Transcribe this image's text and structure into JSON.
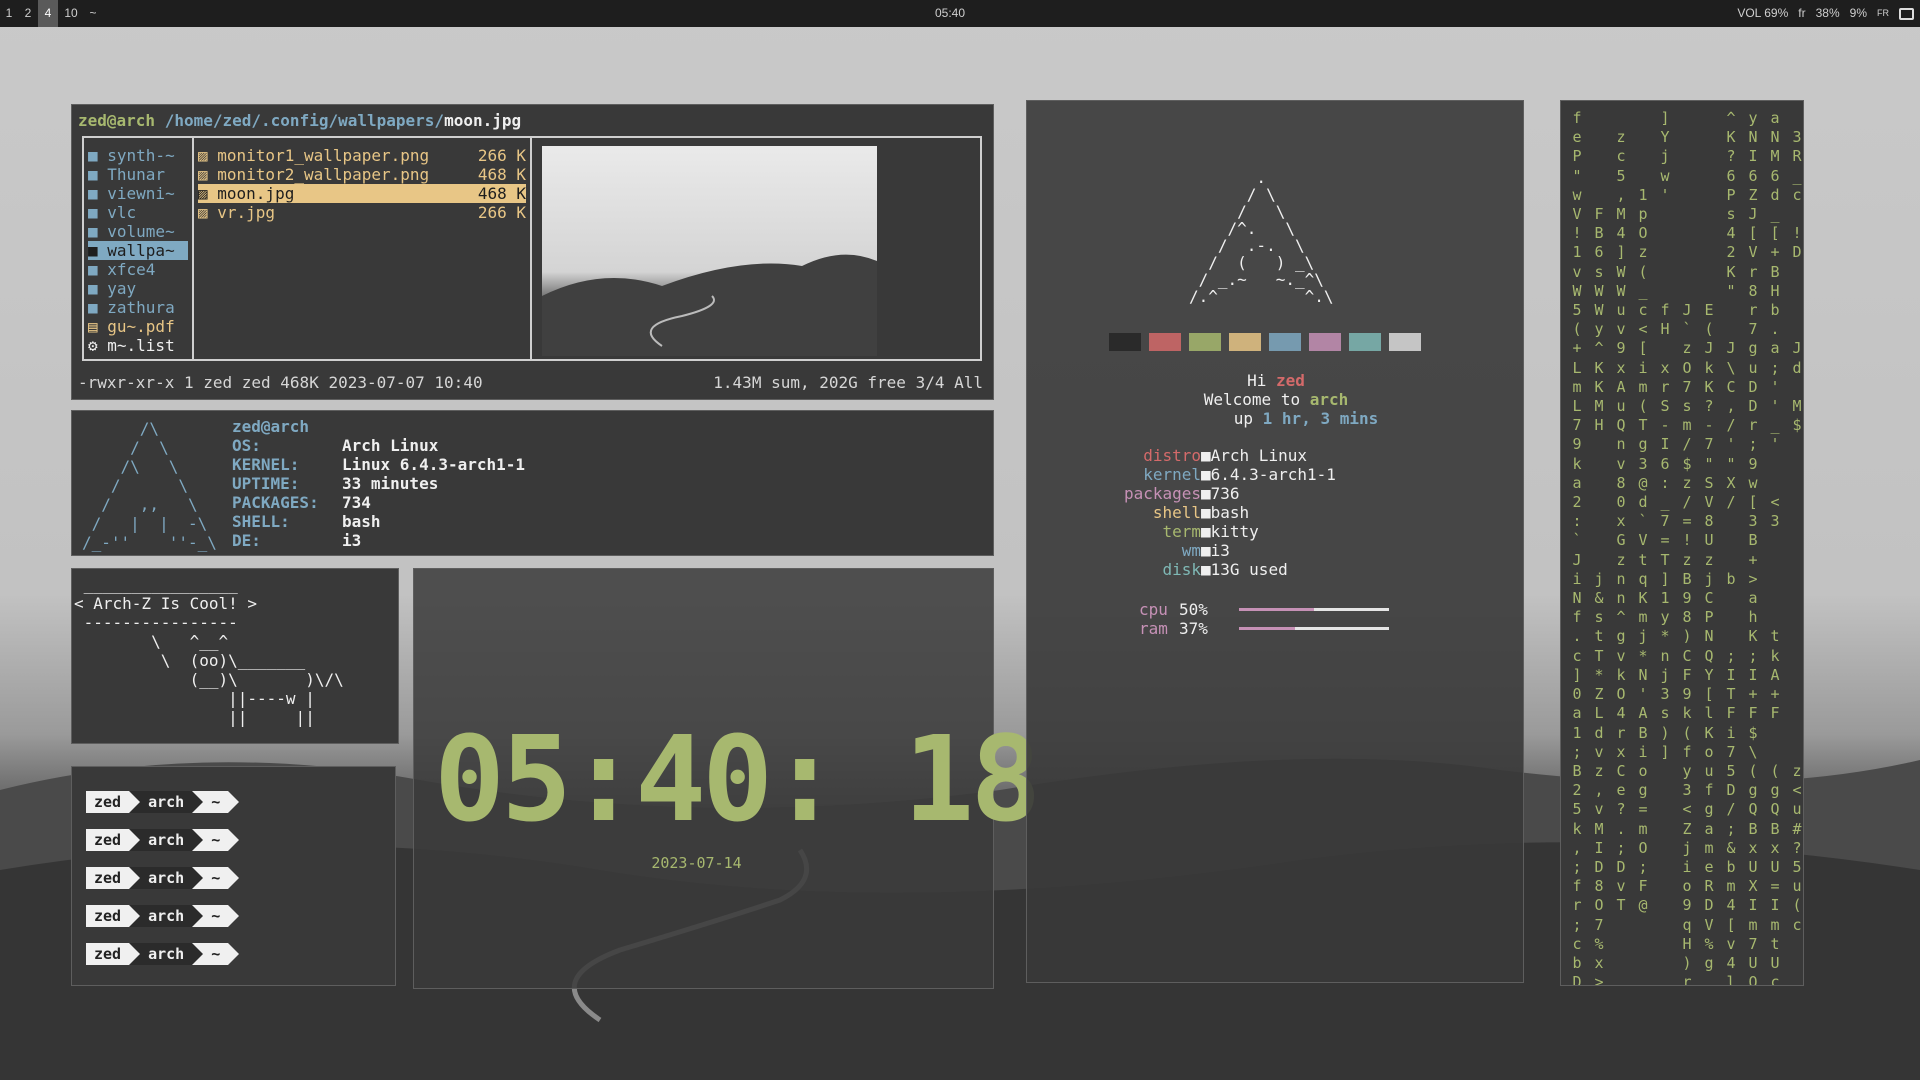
{
  "topbar": {
    "workspaces": [
      "1",
      "2",
      "4",
      "10",
      "~"
    ],
    "active_workspace": "4",
    "clock": "05:40",
    "status": {
      "vol": "VOL",
      "vol_value": "69%",
      "layout": "fr",
      "battery": "38%",
      "cpu": "9%",
      "lang": "FR"
    }
  },
  "file_manager": {
    "path_user": "zed@arch",
    "path_dir": "/home/zed/.config/wallpapers/",
    "path_file": "moon.jpg",
    "dirs": [
      "synth-~",
      "Thunar",
      "viewni~",
      "vlc",
      "volume~",
      "wallpa~",
      "xfce4",
      "yay",
      "zathura",
      "gu~.pdf",
      "m~.list"
    ],
    "selected_dir": "wallpa~",
    "files": [
      {
        "name": "monitor1_wallpaper.png",
        "size": "266 K"
      },
      {
        "name": "monitor2_wallpaper.png",
        "size": "468 K"
      },
      {
        "name": "moon.jpg",
        "size": "468 K"
      },
      {
        "name": "vr.jpg",
        "size": "266 K"
      }
    ],
    "selected_file": "moon.jpg",
    "status_left": "-rwxr-xr-x 1 zed zed 468K 2023-07-07 10:40",
    "status_right": "1.43M sum, 202G free  3/4  All"
  },
  "neofetch": {
    "user": "zed@arch",
    "rows": [
      {
        "key": "OS:",
        "value": "Arch Linux"
      },
      {
        "key": "KERNEL:",
        "value": "Linux 6.4.3-arch1-1"
      },
      {
        "key": "UPTIME:",
        "value": "33 minutes"
      },
      {
        "key": "PACKAGES:",
        "value": "734"
      },
      {
        "key": "SHELL:",
        "value": "bash"
      },
      {
        "key": "DE:",
        "value": "i3"
      }
    ]
  },
  "cowsay": {
    "text": " ________________\n< Arch-Z Is Cool! >\n ----------------\n        \\   ^__^\n         \\  (oo)\\_______\n            (__)\\       )\\/\\\n                ||----w |\n                ||     ||"
  },
  "prompts": {
    "user": "zed",
    "host": "arch",
    "dir": "~",
    "count": 5
  },
  "big_clock": {
    "time": "05:40: 18",
    "date": "2023-07-14"
  },
  "fetch": {
    "greeting_hi": "Hi",
    "greeting_user": "zed",
    "welcome": "Welcome to",
    "welcome_host": "arch",
    "up_label": "up",
    "up_value": "1 hr, 3 mins",
    "info": [
      {
        "key": "distro",
        "value": "Arch Linux",
        "color": "#d46a6a"
      },
      {
        "key": "kernel",
        "value": "6.4.3-arch1-1",
        "color": "#7fa9c2"
      },
      {
        "key": "packages",
        "value": "736",
        "color": "#c691b6"
      },
      {
        "key": "shell",
        "value": "bash",
        "color": "#e8c686"
      },
      {
        "key": "term",
        "value": "kitty",
        "color": "#a7b86f"
      },
      {
        "key": "wm",
        "value": "i3",
        "color": "#7fa9c2"
      },
      {
        "key": "disk",
        "value": "13G used",
        "color": "#7fb8b5"
      }
    ],
    "cpu_label": "cpu",
    "cpu_value": "50%",
    "cpu_fraction": 0.5,
    "ram_label": "ram",
    "ram_value": "37%",
    "ram_fraction": 0.37,
    "palette": [
      "#262626",
      "#d46a6a",
      "#a7b86f",
      "#e8c686",
      "#7fa9c2",
      "#c691b6",
      "#7fb8b5",
      "#dcdcdc"
    ]
  },
  "matrix": {
    "columns": [
      "f\ne\nP\n\"\nw\nV\n!\n1\nv\nW\n5\n(\n+\nL\nm\nL\n7\n9\nk\na\n2\n:\n`\nJ\ni\nN\nf\n.\nc\n]\n0\na\n1\n;\nB\n2\n5\nk\n,\n;\nf\nr\n;\nc\nb\nD",
      "\n\n\n\n\nF\nB\n6\ns\nW\nW\ny\n^\nK\nK\nM\nH\n\n\n\n\n\n\n\nj\n&\ns\nt\nT\n*\nZ\nL\nd\nv\nz\n,\nv\nM\nI\nD\n8\nO\n7\n%\nx\n>",
      "\nz\nc\n5\n,\nM\n4\n]\nW\nW\nu\nv\n9\nx\nA\nu\nQ\nn\nv\n8\n0\nx\nG\nz\nn\nn\n^\ng\nv\nk\nO\n4\nr\nx\nC\ne\n?\n.\n;\nD\nv\nT\n\n\n\n",
      "\n\n\n\n1\np\nO\nz\n(\n_\nc\n<\n[\ni\nm\n(\nT\ng\n3\n@\nd\n`\nV\nt\nq\nK\nm\nj\n*\nN\n'\nA\nB\ni\no\ng\n=\nm\nO\n;\nF\n@\n\n\n\n",
      "]\nY\nj\nw\n'\n\n\n\n\n\nf\nH\n\nx\nr\nS\n-\nI\n6\n:\n_\n7\n=\nT\n]\n1\ny\n*\nn\nj\n3\ns\n)\n]\n\n\n\n\n\n\n\n\n\n\n\n",
      "\n\n\n\n\n\n\n\n\n\nJ\n`\nz\nO\n7\ns\nm\n/\n$\nz\n/\n=\n!\nz\nB\n9\n8\n)\nC\nF\n9\nk\n(\nf\ny\n3\n<\nZ\nj\ni\no\n9\nq\nH\n)\nr",
      "\n\n\n\n\n\n\n\n\n\nE\n(\nJ\nk\nK\n?\n-\n7\n\"\nS\nV\n8\nU\nz\nj\nC\nP\nN\nQ\nY\n[\nl\nK\no\nu\nf\ng\na\nm\ne\nR\nD\nV\n%\ng",
      "^\nK\n?\n6\nP\ns\n4\n2\nK\n\"\n\n\nJ\n\\\nC\n,\n/\n'\n\"\nX\n/\n\n\n\nb\n\n\n\n;\nI\nT\nF\ni\n7\n5\nD\n/\n;\n&\nb\nm\n4\n[\nv\n4\nl",
      "y\nN\nI\n6\nZ\nJ\n[\nV\nr\n8\nr\n7\ng\nu\nD\nD\nr\n;\n9\nw\n[\n3\nB\n+\n>\na\nh\nK\n;\nI\n+\nF\n$\n\\\n(\ng\nQ\nB\nx\nU\nX\nI\nm\n7\nU\nQ",
      "a\nN\nM\n6\nd\n_\n[\n+\nB\nH\nb\n.\na\n;\n'\n'\n_\n'\n\n\n<\n3\n\n\n\n\n\nt\nk\nA\n+\nF\n\n\n(\ng\nQ\nB\nx\nU\n=\nI\nm\nt\nU\nc",
      "\n3\nR\n_\nc\n\n!\nD\n\n\n\n\nJ\nd\n\nM\n$\n\n\n\n\n\n\n\n\n\n\n\n\n\n\n\n\n\nz\n<\nu\n#\n?\n5\nu\n(\nc\n\n\n"
    ]
  }
}
